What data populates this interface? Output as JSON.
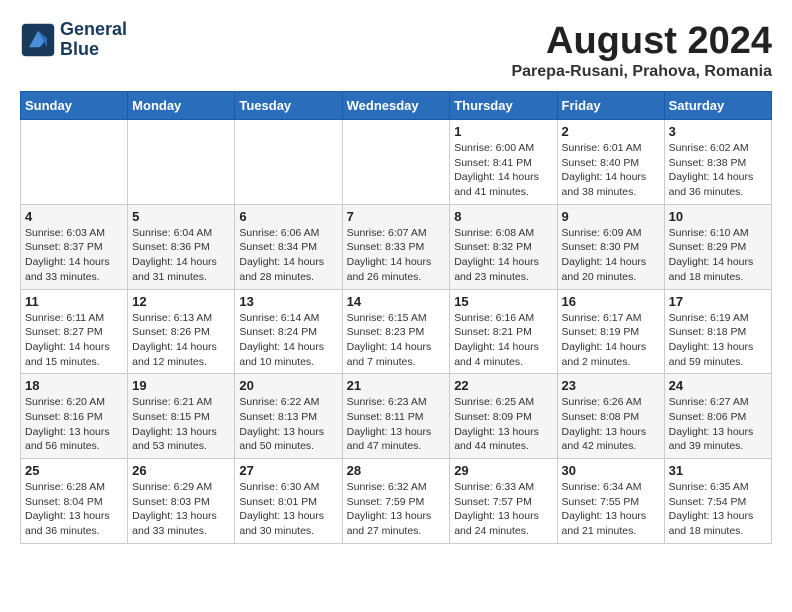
{
  "logo": {
    "line1": "General",
    "line2": "Blue"
  },
  "title": "August 2024",
  "location": "Parepa-Rusani, Prahova, Romania",
  "days_of_week": [
    "Sunday",
    "Monday",
    "Tuesday",
    "Wednesday",
    "Thursday",
    "Friday",
    "Saturday"
  ],
  "weeks": [
    [
      {
        "day": "",
        "info": ""
      },
      {
        "day": "",
        "info": ""
      },
      {
        "day": "",
        "info": ""
      },
      {
        "day": "",
        "info": ""
      },
      {
        "day": "1",
        "info": "Sunrise: 6:00 AM\nSunset: 8:41 PM\nDaylight: 14 hours and 41 minutes."
      },
      {
        "day": "2",
        "info": "Sunrise: 6:01 AM\nSunset: 8:40 PM\nDaylight: 14 hours and 38 minutes."
      },
      {
        "day": "3",
        "info": "Sunrise: 6:02 AM\nSunset: 8:38 PM\nDaylight: 14 hours and 36 minutes."
      }
    ],
    [
      {
        "day": "4",
        "info": "Sunrise: 6:03 AM\nSunset: 8:37 PM\nDaylight: 14 hours and 33 minutes."
      },
      {
        "day": "5",
        "info": "Sunrise: 6:04 AM\nSunset: 8:36 PM\nDaylight: 14 hours and 31 minutes."
      },
      {
        "day": "6",
        "info": "Sunrise: 6:06 AM\nSunset: 8:34 PM\nDaylight: 14 hours and 28 minutes."
      },
      {
        "day": "7",
        "info": "Sunrise: 6:07 AM\nSunset: 8:33 PM\nDaylight: 14 hours and 26 minutes."
      },
      {
        "day": "8",
        "info": "Sunrise: 6:08 AM\nSunset: 8:32 PM\nDaylight: 14 hours and 23 minutes."
      },
      {
        "day": "9",
        "info": "Sunrise: 6:09 AM\nSunset: 8:30 PM\nDaylight: 14 hours and 20 minutes."
      },
      {
        "day": "10",
        "info": "Sunrise: 6:10 AM\nSunset: 8:29 PM\nDaylight: 14 hours and 18 minutes."
      }
    ],
    [
      {
        "day": "11",
        "info": "Sunrise: 6:11 AM\nSunset: 8:27 PM\nDaylight: 14 hours and 15 minutes."
      },
      {
        "day": "12",
        "info": "Sunrise: 6:13 AM\nSunset: 8:26 PM\nDaylight: 14 hours and 12 minutes."
      },
      {
        "day": "13",
        "info": "Sunrise: 6:14 AM\nSunset: 8:24 PM\nDaylight: 14 hours and 10 minutes."
      },
      {
        "day": "14",
        "info": "Sunrise: 6:15 AM\nSunset: 8:23 PM\nDaylight: 14 hours and 7 minutes."
      },
      {
        "day": "15",
        "info": "Sunrise: 6:16 AM\nSunset: 8:21 PM\nDaylight: 14 hours and 4 minutes."
      },
      {
        "day": "16",
        "info": "Sunrise: 6:17 AM\nSunset: 8:19 PM\nDaylight: 14 hours and 2 minutes."
      },
      {
        "day": "17",
        "info": "Sunrise: 6:19 AM\nSunset: 8:18 PM\nDaylight: 13 hours and 59 minutes."
      }
    ],
    [
      {
        "day": "18",
        "info": "Sunrise: 6:20 AM\nSunset: 8:16 PM\nDaylight: 13 hours and 56 minutes."
      },
      {
        "day": "19",
        "info": "Sunrise: 6:21 AM\nSunset: 8:15 PM\nDaylight: 13 hours and 53 minutes."
      },
      {
        "day": "20",
        "info": "Sunrise: 6:22 AM\nSunset: 8:13 PM\nDaylight: 13 hours and 50 minutes."
      },
      {
        "day": "21",
        "info": "Sunrise: 6:23 AM\nSunset: 8:11 PM\nDaylight: 13 hours and 47 minutes."
      },
      {
        "day": "22",
        "info": "Sunrise: 6:25 AM\nSunset: 8:09 PM\nDaylight: 13 hours and 44 minutes."
      },
      {
        "day": "23",
        "info": "Sunrise: 6:26 AM\nSunset: 8:08 PM\nDaylight: 13 hours and 42 minutes."
      },
      {
        "day": "24",
        "info": "Sunrise: 6:27 AM\nSunset: 8:06 PM\nDaylight: 13 hours and 39 minutes."
      }
    ],
    [
      {
        "day": "25",
        "info": "Sunrise: 6:28 AM\nSunset: 8:04 PM\nDaylight: 13 hours and 36 minutes."
      },
      {
        "day": "26",
        "info": "Sunrise: 6:29 AM\nSunset: 8:03 PM\nDaylight: 13 hours and 33 minutes."
      },
      {
        "day": "27",
        "info": "Sunrise: 6:30 AM\nSunset: 8:01 PM\nDaylight: 13 hours and 30 minutes."
      },
      {
        "day": "28",
        "info": "Sunrise: 6:32 AM\nSunset: 7:59 PM\nDaylight: 13 hours and 27 minutes."
      },
      {
        "day": "29",
        "info": "Sunrise: 6:33 AM\nSunset: 7:57 PM\nDaylight: 13 hours and 24 minutes."
      },
      {
        "day": "30",
        "info": "Sunrise: 6:34 AM\nSunset: 7:55 PM\nDaylight: 13 hours and 21 minutes."
      },
      {
        "day": "31",
        "info": "Sunrise: 6:35 AM\nSunset: 7:54 PM\nDaylight: 13 hours and 18 minutes."
      }
    ]
  ]
}
